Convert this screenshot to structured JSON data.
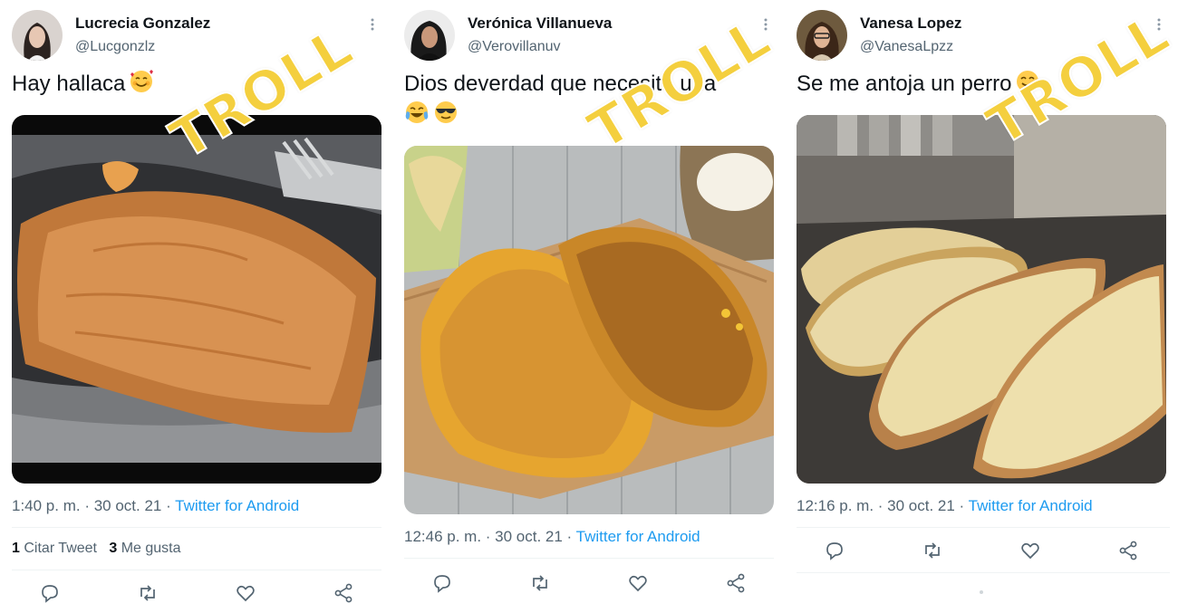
{
  "watermark": "TROLL",
  "tweets": [
    {
      "name": "Lucrecia Gonzalez",
      "handle": "@Lucgonzlz",
      "text": "Hay hallaca",
      "emoji": "smiling-face-with-hearts",
      "time": "1:40 p. m. · 30 oct. 21 · ",
      "source": "Twitter for Android",
      "quote_count": "1",
      "quote_label": "Citar Tweet",
      "like_count": "3",
      "like_label": "Me gusta"
    },
    {
      "name": "Verónica Villanueva",
      "handle": "@Verovillanuv",
      "text_line1": "Dios deverdad que necesito una",
      "emoji": [
        "face-with-tears-of-joy",
        "smiling-face-with-sunglasses"
      ],
      "time": "12:46 p. m. · 30 oct. 21 · ",
      "source": "Twitter for Android"
    },
    {
      "name": "Vanesa Lopez",
      "handle": "@VanesaLpzz",
      "text": "Se me antoja un perro",
      "emoji": "face-savoring-food",
      "time": "12:16 p. m. · 30 oct. 21 · ",
      "source": "Twitter for Android"
    }
  ],
  "colors": {
    "link": "#1d9bf0",
    "secondary": "#536471",
    "watermark": "#f4cf3e"
  }
}
